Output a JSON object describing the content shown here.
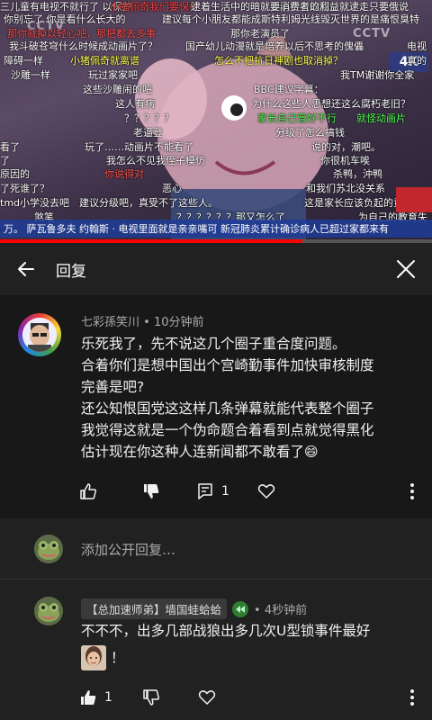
{
  "video": {
    "danmaku": [
      {
        "text": "三儿童有电视不就行了  以保护",
        "color": "#ffffff"
      },
      {
        "text": "小猪佩奇我们要保护",
        "color": "#ff4444"
      },
      {
        "text": "逮着生活中的暗就是小学生以成...",
        "color": "#ffffff"
      },
      {
        "text": "要消费者的利益就逮走只要俄说",
        "color": "#ffffff"
      },
      {
        "text": "你别忘了  你是看什么长大的",
        "color": "#ffffff"
      },
      {
        "text": "建议每个小朋友都能成斯特利姆光线毁灭世界的是痛恨臭特",
        "color": "#ffffff"
      },
      {
        "text": "那你就掉以轻心吧，那把都去多事",
        "color": "#ff5555"
      },
      {
        "text": "那你老演员了",
        "color": "#ffffff"
      },
      {
        "text": "我斗破苍穹什么时候成动画片了？",
        "color": "#ffffff"
      },
      {
        "text": "国产幼儿动漫就是培养以后不思考的傀儡",
        "color": "#ffffff"
      },
      {
        "text": "电视",
        "color": "#ffffff"
      },
      {
        "text": "障碍一样",
        "color": "#ffffff"
      },
      {
        "text": "小猪佩奇就离谱",
        "color": "#ffff55"
      },
      {
        "text": "怎么不把抗日神剧也取消掉？",
        "color": "#ffff55"
      },
      {
        "text": "真的",
        "color": "#ffffff"
      },
      {
        "text": "沙雕一样",
        "color": "#ffffff"
      },
      {
        "text": "玩过家家吧",
        "color": "#ffffff"
      },
      {
        "text": "我TM谢谢你全家",
        "color": "#ffffff"
      },
      {
        "text": "这些沙雕闹的吧",
        "color": "#ffffff"
      },
      {
        "text": "BBC建议字幕：",
        "color": "#ffffff"
      },
      {
        "text": "这人有病",
        "color": "#ffffff"
      },
      {
        "text": "为什么这些人思想还这么腐朽老旧？",
        "color": "#ffffff"
      },
      {
        "text": "？？？？？",
        "color": "#ffffff"
      },
      {
        "text": "家长自己管好不行",
        "color": "#55ff55"
      },
      {
        "text": "就怪动画片",
        "color": "#55ff55"
      },
      {
        "text": "老逼登",
        "color": "#ffffff"
      },
      {
        "text": "分级了怎么搞钱",
        "color": "#ffffff"
      },
      {
        "text": "看了",
        "color": "#ffffff"
      },
      {
        "text": "玩了……动画片不能看了",
        "color": "#ffffff"
      },
      {
        "text": "说的对，潮吧。",
        "color": "#ffffff"
      },
      {
        "text": "了",
        "color": "#ffffff"
      },
      {
        "text": "我怎么不见我侄子模仿",
        "color": "#ffffff"
      },
      {
        "text": "你很机车唉",
        "color": "#ffffff"
      },
      {
        "text": "原因的",
        "color": "#ffffff"
      },
      {
        "text": "你说得对",
        "color": "#ff5555"
      },
      {
        "text": "杀鸭，沖鸭",
        "color": "#ffffff"
      },
      {
        "text": "了死谁了？",
        "color": "#ffffff"
      },
      {
        "text": "恶心",
        "color": "#ffffff"
      },
      {
        "text": "和我们苏北没关系",
        "color": "#ffffff"
      },
      {
        "text": "tmd小学没去吧",
        "color": "#ffffff"
      },
      {
        "text": "建议分级吧，真受不了这些人。",
        "color": "#ffffff"
      },
      {
        "text": "这是家长应该负起的责任，全推",
        "color": "#ffffff"
      },
      {
        "text": "煞笔",
        "color": "#ffffff"
      },
      {
        "text": "？？？？？？那又怎么了",
        "color": "#ffffff"
      },
      {
        "text": "为自己的教育失",
        "color": "#ffffff"
      }
    ],
    "logo_left": "CCTV",
    "logo_right": "CCTV",
    "hd_badge": "4K",
    "ticker": "万。   萨瓦鲁多夫    约翰斯 · 电视里面就是亲亲嘴可 新冠肺炎累计确诊病人已超过家都来有",
    "progress_fraction": 0.7
  },
  "header": {
    "title": "回复",
    "back_icon": "arrow-left-icon",
    "close_icon": "close-icon"
  },
  "parent_comment": {
    "author": "七彩孫笑川",
    "time": "• 10分钟前",
    "lines": [
      "乐死我了，先不说这几个圈子重合度问题。",
      "合着你们是想中国出个宫崎勤事件加快审核制度",
      "完善是吧?",
      "还公知恨国党这这样几条弹幕就能代表整个圈子",
      "我觉得这就是一个伪命题合着看到点就觉得黑化",
      "估计现在你这种人连新闻都不敢看了"
    ],
    "emoji": "😄",
    "reply_count": "1"
  },
  "add_reply": {
    "placeholder": "添加公开回复…"
  },
  "reply": {
    "author": "【总加速师弟】墙国蛙蛤蛤",
    "time": "• 4秒钟前",
    "text": "不不不，出多几部战狼出多几次U型锁事件最好",
    "trailing": "！",
    "like_count": "1"
  },
  "colors": {
    "background": "#212121",
    "parent_background": "#181818",
    "accent_red": "#ff0000",
    "meta": "#aaaaaa"
  }
}
